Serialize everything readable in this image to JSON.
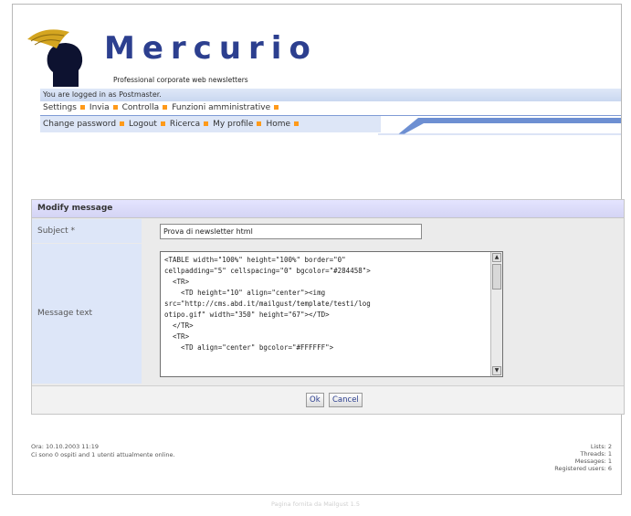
{
  "brand": {
    "name": "Mercurio",
    "tagline": "Professional corporate web newsletters",
    "logo_icon": "feather-head-logo"
  },
  "session": {
    "logged_in_text": "You are logged in as Postmaster."
  },
  "menu_primary": [
    {
      "label": "Settings"
    },
    {
      "label": "Invia"
    },
    {
      "label": "Controlla"
    },
    {
      "label": "Funzioni amministrative"
    }
  ],
  "menu_secondary": [
    {
      "label": "Change password"
    },
    {
      "label": "Logout"
    },
    {
      "label": "Ricerca"
    },
    {
      "label": "My profile"
    },
    {
      "label": "Home"
    }
  ],
  "form": {
    "title": "Modify message",
    "subject_label": "Subject *",
    "subject_value": "Prova di newsletter html",
    "message_label": "Message text",
    "message_lines": [
      "<TABLE width=\"100%\" height=\"100%\" border=\"0\"",
      "cellpadding=\"5\" cellspacing=\"0\" bgcolor=\"#284458\">",
      "  <TR>",
      "    <TD height=\"10\" align=\"center\"><img",
      "src=\"http://cms.abd.it/mailgust/template/testi/log",
      "otipo.gif\" width=\"350\" height=\"67\"></TD>",
      "  </TR>",
      "  <TR>",
      "    <TD align=\"center\" bgcolor=\"#FFFFFF\">"
    ],
    "ok_label": "Ok",
    "cancel_label": "Cancel"
  },
  "footer": {
    "time_line": "Ora: 10.10.2003 11:19",
    "online_line": "Ci sono 0 ospiti and 1 utenti attualmente online.",
    "stats": [
      "Lists: 2",
      "Threads: 1",
      "Messages: 1",
      "Registered users: 6"
    ]
  },
  "credit": "Pagina fornita da Mailgust 1.5",
  "colors": {
    "accent": "#2c3f8f",
    "bullet": "#ff9a1a",
    "menu_bg": "#dde6f7",
    "panel_header": "#d8d8f6"
  }
}
